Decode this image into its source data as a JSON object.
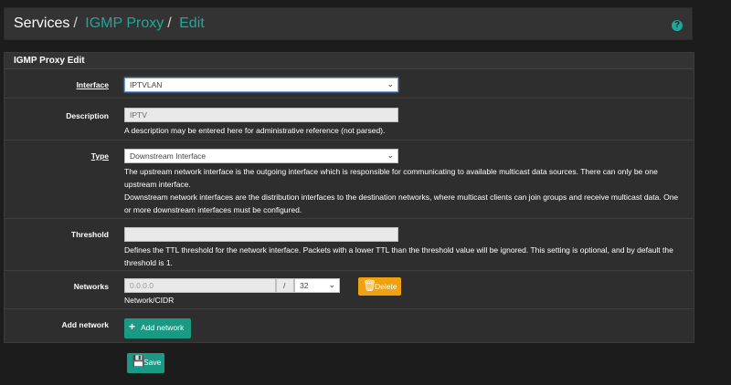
{
  "breadcrumb": {
    "services": "Services",
    "sep1": "/",
    "igmp": "IGMP Proxy",
    "sep2": "/",
    "edit": "Edit",
    "help_icon": "?"
  },
  "panel": {
    "title": "IGMP Proxy Edit"
  },
  "interface": {
    "label": "Interface",
    "value": "IPTVLAN"
  },
  "description": {
    "label": "Description",
    "value": "IPTV",
    "help": "A description may be entered here for administrative reference (not parsed)."
  },
  "type": {
    "label": "Type",
    "value": "Downstream Interface",
    "help1": "The upstream network interface is the outgoing interface which is responsible for communicating to available multicast data sources. There can only be one upstream interface.",
    "help2": "Downstream network interfaces are the distribution interfaces to the destination networks, where multicast clients can join groups and receive multicast data. One or more downstream interfaces must be configured."
  },
  "threshold": {
    "label": "Threshold",
    "value": "",
    "help": "Defines the TTL threshold for the network interface. Packets with a lower TTL than the threshold value will be ignored. This setting is optional, and by default the threshold is 1."
  },
  "networks": {
    "label": "Networks",
    "placeholder": "0.0.0.0",
    "slash": "/",
    "cidr": "32",
    "help": "Network/CIDR",
    "delete_label": "Delete"
  },
  "add_network": {
    "label": "Add network",
    "button_label": "Add network"
  },
  "save": {
    "label": "Save"
  },
  "colors": {
    "accent": "#1fa89a",
    "button_green": "#1a9a82",
    "button_orange": "#f0a10f"
  }
}
